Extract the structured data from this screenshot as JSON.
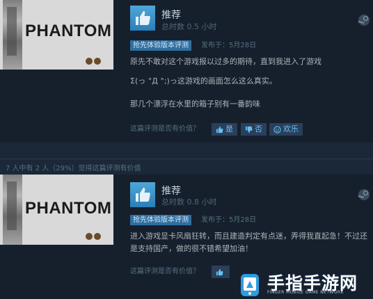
{
  "reviews": [
    {
      "thumbnail_title": "PHANTOM",
      "verdict": "推荐",
      "hours": "总时数 0.5 小时",
      "badge": "抢先体验版本评测",
      "posted": "发布于：5月28日",
      "paragraphs": [
        "原先不敢对这个游戏报以过多的期待，直到我进入了游戏",
        "Σ(っ °Д °;)っ这游戏的画面怎么这么真实。",
        "那几个漂浮在水里的箱子别有一番韵味"
      ],
      "helpful_question": "这篇评测是否有价值？",
      "yes_label": "是",
      "no_label": "否",
      "funny_label": "欢乐"
    },
    {
      "thumbnail_title": "PHANTOM",
      "verdict": "推荐",
      "hours": "总时数 0.8 小时",
      "badge": "抢先体验版本评测",
      "posted": "发布于：5月28日",
      "paragraphs": [
        "进入游戏显卡风扇狂转，而且建造判定有点迷，弄得我直起急！不过还是支持国产，做的很不错希望加油！"
      ],
      "helpful_question": "这篇评测是否有价值？"
    }
  ],
  "helpful_stats": "7 人中有 2 人（29%）觉得这篇评测有价值",
  "watermark": {
    "title": "手指手游网",
    "subtitle": "FINGER MOBILE GAME NETWORK"
  },
  "colors": {
    "background": "#1b2838",
    "review_bg": "#16202d",
    "accent": "#66c0f4",
    "badge": "#2f6fa0"
  },
  "icons": {
    "thumbs_up": "thumbs-up-icon",
    "steam": "steam-icon",
    "vote_yes": "thumbs-up-small-icon",
    "vote_no": "thumbs-down-small-icon",
    "vote_funny": "smiley-icon"
  }
}
